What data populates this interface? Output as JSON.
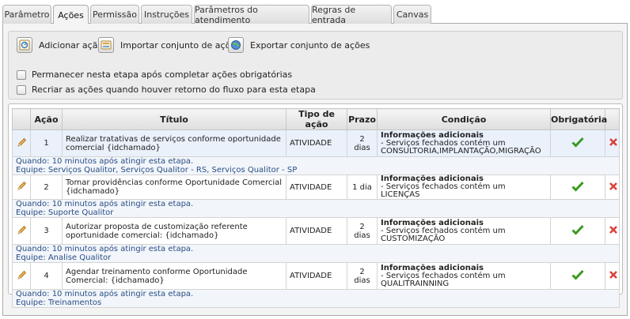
{
  "tabs": [
    {
      "label": "Parâmetro",
      "active": false
    },
    {
      "label": "Ações",
      "active": true
    },
    {
      "label": "Permissão",
      "active": false
    },
    {
      "label": "Instruções",
      "active": false
    },
    {
      "label": "Parâmetros do atendimento",
      "active": false
    },
    {
      "label": "Regras de entrada",
      "active": false
    },
    {
      "label": "Canvas",
      "active": false
    }
  ],
  "toolbar": {
    "add_label": "Adicionar ação",
    "import_label": "Importar conjunto de ações",
    "export_label": "Exportar conjunto de ações"
  },
  "options": {
    "stay_label": "Permanecer nesta etapa após completar ações obrigatórias",
    "recreate_label": "Recriar as ações quando houver retorno do fluxo para esta etapa"
  },
  "table": {
    "headers": [
      "Ação",
      "Título",
      "Tipo de ação",
      "Prazo",
      "Condição",
      "Obrigatória"
    ],
    "rows": [
      {
        "acao": "1",
        "titulo": "Realizar tratativas de serviços conforme oportunidade comercial {idchamado}",
        "tipo": "ATIVIDADE",
        "prazo": "2 dias",
        "cond_title": "Informações adicionais",
        "cond_text": "- Serviços fechados contém um CONSULTORIA,IMPLANTAÇÃO,MIGRAÇÃO",
        "quando": "Quando: 10 minutos após atingir esta etapa.",
        "equipe": "Equipe: Serviços Qualitor, Serviços Qualitor - RS, Serviços Qualitor - SP"
      },
      {
        "acao": "2",
        "titulo": "Tomar providências conforme Oportunidade Comercial {idchamado}",
        "tipo": "ATIVIDADE",
        "prazo": "1 dia",
        "cond_title": "Informações adicionais",
        "cond_text": "- Serviços fechados contém um LICENÇAS",
        "quando": "Quando: 10 minutos após atingir esta etapa.",
        "equipe": "Equipe: Suporte Qualitor"
      },
      {
        "acao": "3",
        "titulo": "Autorizar proposta de customização referente oportunidade comercial: {idchamado}",
        "tipo": "ATIVIDADE",
        "prazo": "2 dias",
        "cond_title": "Informações adicionais",
        "cond_text": "- Serviços fechados contém um CUSTOMIZAÇÃO",
        "quando": "Quando: 10 minutos após atingir esta etapa.",
        "equipe": "Equipe: Analise Qualitor"
      },
      {
        "acao": "4",
        "titulo": "Agendar treinamento conforme Oportunidade Comercial: {idchamado}",
        "tipo": "ATIVIDADE",
        "prazo": "2 dias",
        "cond_title": "Informações adicionais",
        "cond_text": "- Serviços fechados contém um QUALITRAINNING",
        "quando": "Quando: 10 minutos após atingir esta etapa.",
        "equipe": "Equipe: Treinamentos"
      }
    ]
  },
  "icons": {
    "edit": "pencil-icon",
    "mandatory": "checkmark-icon",
    "delete": "delete-x-icon",
    "add": "add-action-icon",
    "import": "import-icon",
    "export": "export-globe-icon"
  },
  "colors": {
    "info_text": "#2a4d83",
    "check_green": "#3a9a1e",
    "delete_red": "#d9413a",
    "selected_row": "#eaf1fb"
  }
}
